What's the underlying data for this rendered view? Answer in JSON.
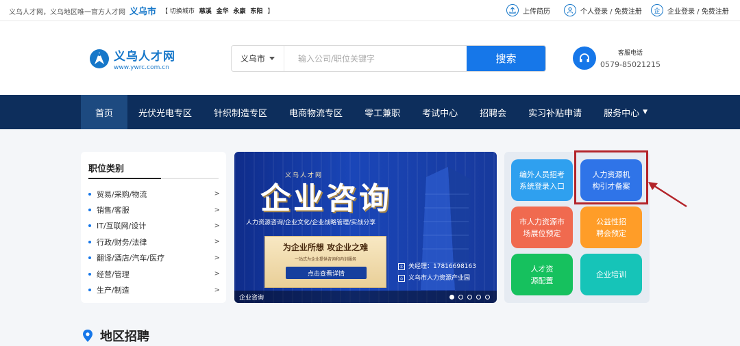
{
  "topbar": {
    "intro": "义乌人才网，义乌地区唯一官方人才网",
    "current_city": "义乌市",
    "switch_label": "【 切换城市",
    "cities": [
      "慈溪",
      "金华",
      "永康",
      "东阳"
    ],
    "switch_end": "】",
    "upload_resume": "上传简历",
    "personal_login": "个人登录 / 免费注册",
    "company_login": "企业登录 / 免费注册",
    "company_icon_char": "企"
  },
  "header": {
    "logo_name": "义乌人才网",
    "logo_url": "www.ywrc.com.cn",
    "search": {
      "city": "义乌市",
      "placeholder": "输入公司/职位关键字",
      "button": "搜索"
    },
    "service_label": "客服电话",
    "service_phone": "0579-85021215"
  },
  "nav": {
    "items": [
      "首页",
      "光伏光电专区",
      "针织制造专区",
      "电商物流专区",
      "零工兼职",
      "考试中心",
      "招聘会",
      "实习补贴申请",
      "服务中心"
    ]
  },
  "categories": {
    "title": "职位类别",
    "items": [
      "贸易/采购/物流",
      "销售/客服",
      "IT/互联网/设计",
      "行政/财务/法律",
      "翻译/酒店/汽车/医疗",
      "经营/管理",
      "生产/制造"
    ]
  },
  "banner": {
    "brand": "义乌人才网",
    "headline": "企业咨询",
    "subline": "人力资源咨询/企业文化/企业战略管理/实战分享",
    "box_title": "为企业所想 攻企业之难",
    "box_sub": "一站式为企业提供咨询和内训服务",
    "cta": "点击查看详情",
    "manager": "关经理：17816698163",
    "address": "义乌市人力资源产业园",
    "caption": "企业咨询"
  },
  "quick_links": [
    {
      "label": "编外人员招考系统登录入口",
      "color": "#2fa0ef"
    },
    {
      "label": "人力资源机构引才备案",
      "color": "#2f74e8"
    },
    {
      "label": "市人力资源市场展位预定",
      "color": "#f06a4f"
    },
    {
      "label": "公益性招聘会预定",
      "color": "#ff9d28"
    },
    {
      "label": "人才资源配置",
      "color": "#16c15e"
    },
    {
      "label": "企业培训",
      "color": "#16c4b8"
    }
  ],
  "region": {
    "title": "地区招聘"
  }
}
